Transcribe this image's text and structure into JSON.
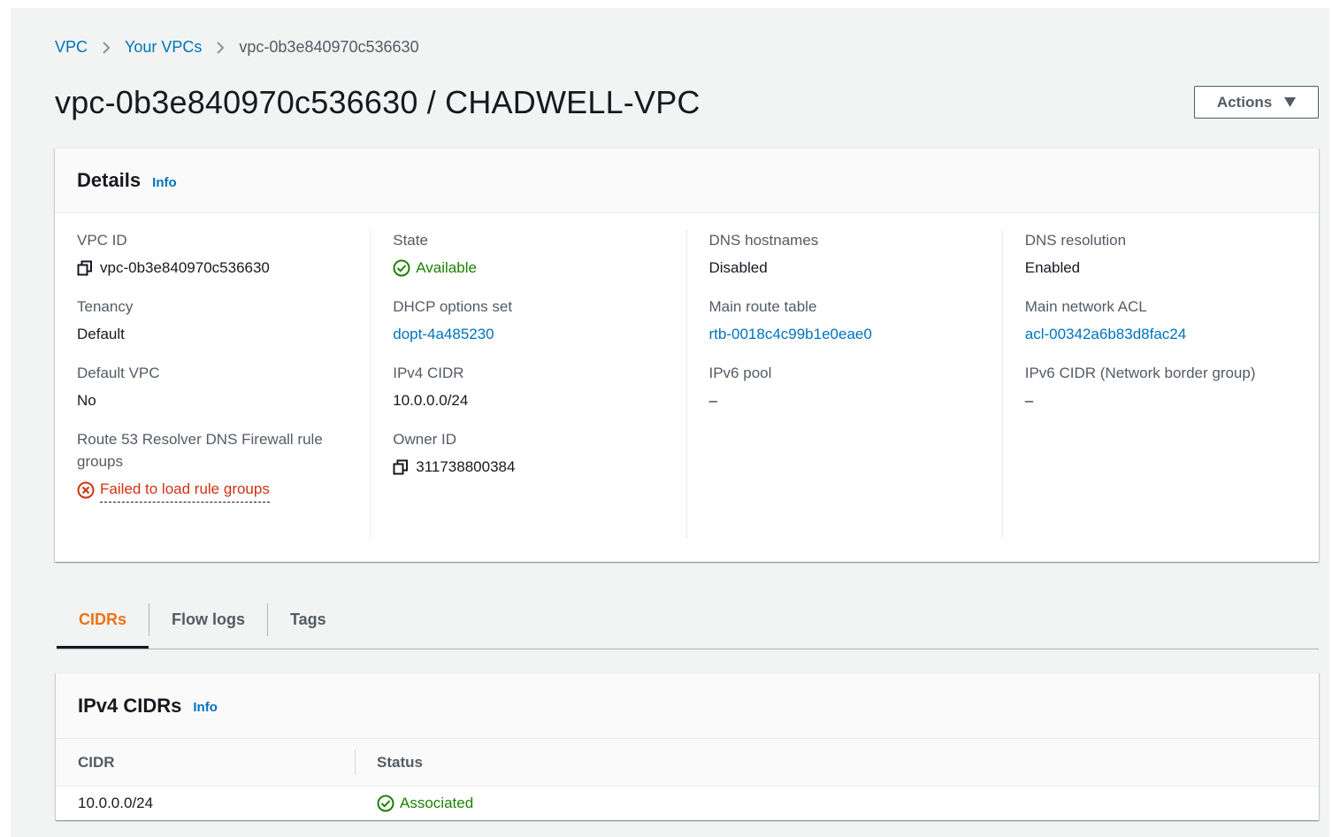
{
  "breadcrumb": {
    "items": [
      {
        "label": "VPC"
      },
      {
        "label": "Your VPCs"
      }
    ],
    "current": "vpc-0b3e840970c536630"
  },
  "page_title": "vpc-0b3e840970c536630 / CHADWELL-VPC",
  "actions_label": "Actions",
  "details": {
    "title": "Details",
    "info": "Info",
    "columns": [
      [
        {
          "label": "VPC ID",
          "value": "vpc-0b3e840970c536630"
        },
        {
          "label": "Tenancy",
          "value": "Default"
        },
        {
          "label": "Default VPC",
          "value": "No"
        },
        {
          "label": "Route 53 Resolver DNS Firewall rule groups",
          "value": "Failed to load rule groups"
        }
      ],
      [
        {
          "label": "State",
          "value": "Available"
        },
        {
          "label": "DHCP options set",
          "value": "dopt-4a485230"
        },
        {
          "label": "IPv4 CIDR",
          "value": "10.0.0.0/24"
        },
        {
          "label": "Owner ID",
          "value": "311738800384"
        }
      ],
      [
        {
          "label": "DNS hostnames",
          "value": "Disabled"
        },
        {
          "label": "Main route table",
          "value": "rtb-0018c4c99b1e0eae0"
        },
        {
          "label": "IPv6 pool",
          "value": "–"
        }
      ],
      [
        {
          "label": "DNS resolution",
          "value": "Enabled"
        },
        {
          "label": "Main network ACL",
          "value": "acl-00342a6b83d8fac24"
        },
        {
          "label": "IPv6 CIDR (Network border group)",
          "value": "–"
        }
      ]
    ]
  },
  "tabs": [
    {
      "label": "CIDRs",
      "active": true
    },
    {
      "label": "Flow logs",
      "active": false
    },
    {
      "label": "Tags",
      "active": false
    }
  ],
  "ipv4_cidrs": {
    "title": "IPv4 CIDRs",
    "info": "Info",
    "columns": [
      "CIDR",
      "Status"
    ],
    "rows": [
      {
        "cidr": "10.0.0.0/24",
        "status": "Associated"
      }
    ]
  },
  "colors": {
    "link": "#0073bb",
    "success": "#1d8102",
    "error": "#d13212",
    "active_tab": "#ec7211",
    "background": "#f2f3f3"
  },
  "icons": {
    "copy": "copy-icon",
    "success": "check-circle-icon",
    "error": "x-circle-icon",
    "breadcrumb_separator": "chevron-right-icon",
    "dropdown": "caret-down-icon"
  }
}
